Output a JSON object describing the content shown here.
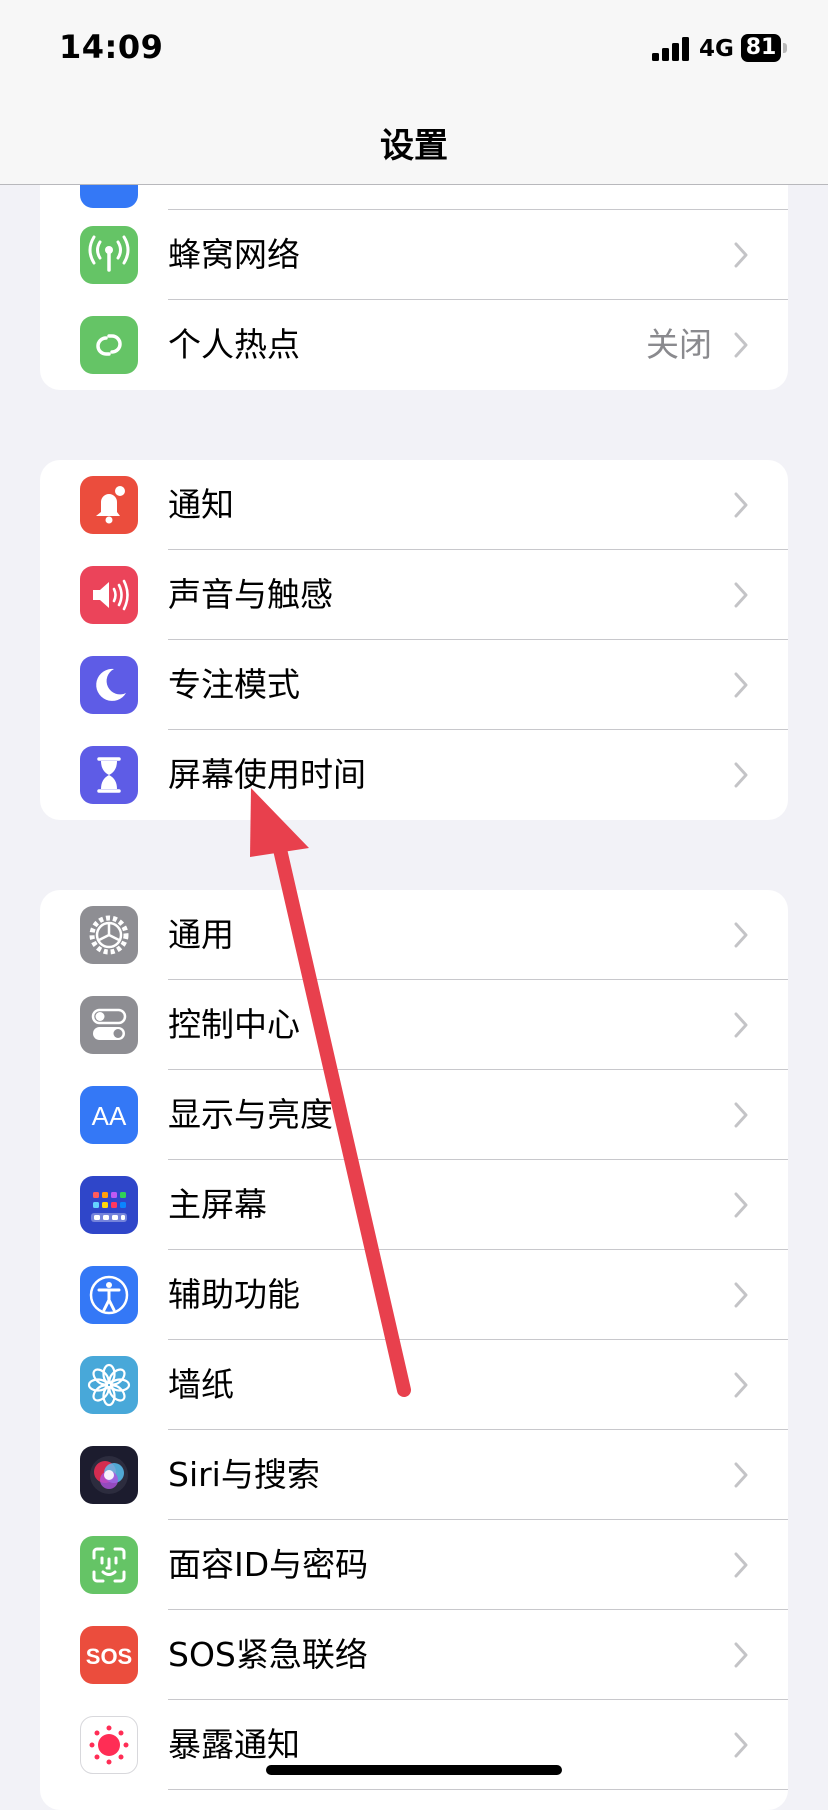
{
  "status_bar": {
    "time": "14:09",
    "network": "4G",
    "battery": "81"
  },
  "nav": {
    "title": "设置"
  },
  "groups": [
    {
      "rows": [
        {
          "label": "蜂窝网络",
          "icon": "cellular-antenna-icon",
          "color": "#65c466"
        },
        {
          "label": "个人热点",
          "value": "关闭",
          "icon": "personal-hotspot-icon",
          "color": "#65c466"
        }
      ]
    },
    {
      "rows": [
        {
          "label": "通知",
          "icon": "notification-bell-icon",
          "color": "#eb4d3d"
        },
        {
          "label": "声音与触感",
          "icon": "speaker-icon",
          "color": "#eb445a"
        },
        {
          "label": "专注模式",
          "icon": "moon-icon",
          "color": "#5e5ce6"
        },
        {
          "label": "屏幕使用时间",
          "icon": "hourglass-icon",
          "color": "#5e5ce6"
        }
      ]
    },
    {
      "rows": [
        {
          "label": "通用",
          "icon": "gear-icon",
          "color": "#8e8e93"
        },
        {
          "label": "控制中心",
          "icon": "toggles-icon",
          "color": "#8e8e93"
        },
        {
          "label": "显示与亮度",
          "icon": "text-size-aa-icon",
          "color": "#3478f6"
        },
        {
          "label": "主屏幕",
          "icon": "home-screen-grid-icon",
          "color": "#2f46c9"
        },
        {
          "label": "辅助功能",
          "icon": "accessibility-person-icon",
          "color": "#3478f6"
        },
        {
          "label": "墙纸",
          "icon": "flower-wallpaper-icon",
          "color": "#48a8d9"
        },
        {
          "label": "Siri与搜索",
          "icon": "siri-orb-icon",
          "color": "#1c1c2e"
        },
        {
          "label": "面容ID与密码",
          "icon": "face-id-icon",
          "color": "#65c466"
        },
        {
          "label": "SOS紧急联络",
          "icon": "sos-text-icon",
          "color": "#eb4d3d",
          "icon_text": "SOS"
        },
        {
          "label": "暴露通知",
          "icon": "exposure-dots-icon",
          "color": "#ffffff"
        }
      ]
    }
  ],
  "annotation": {
    "color": "#e8404d"
  }
}
